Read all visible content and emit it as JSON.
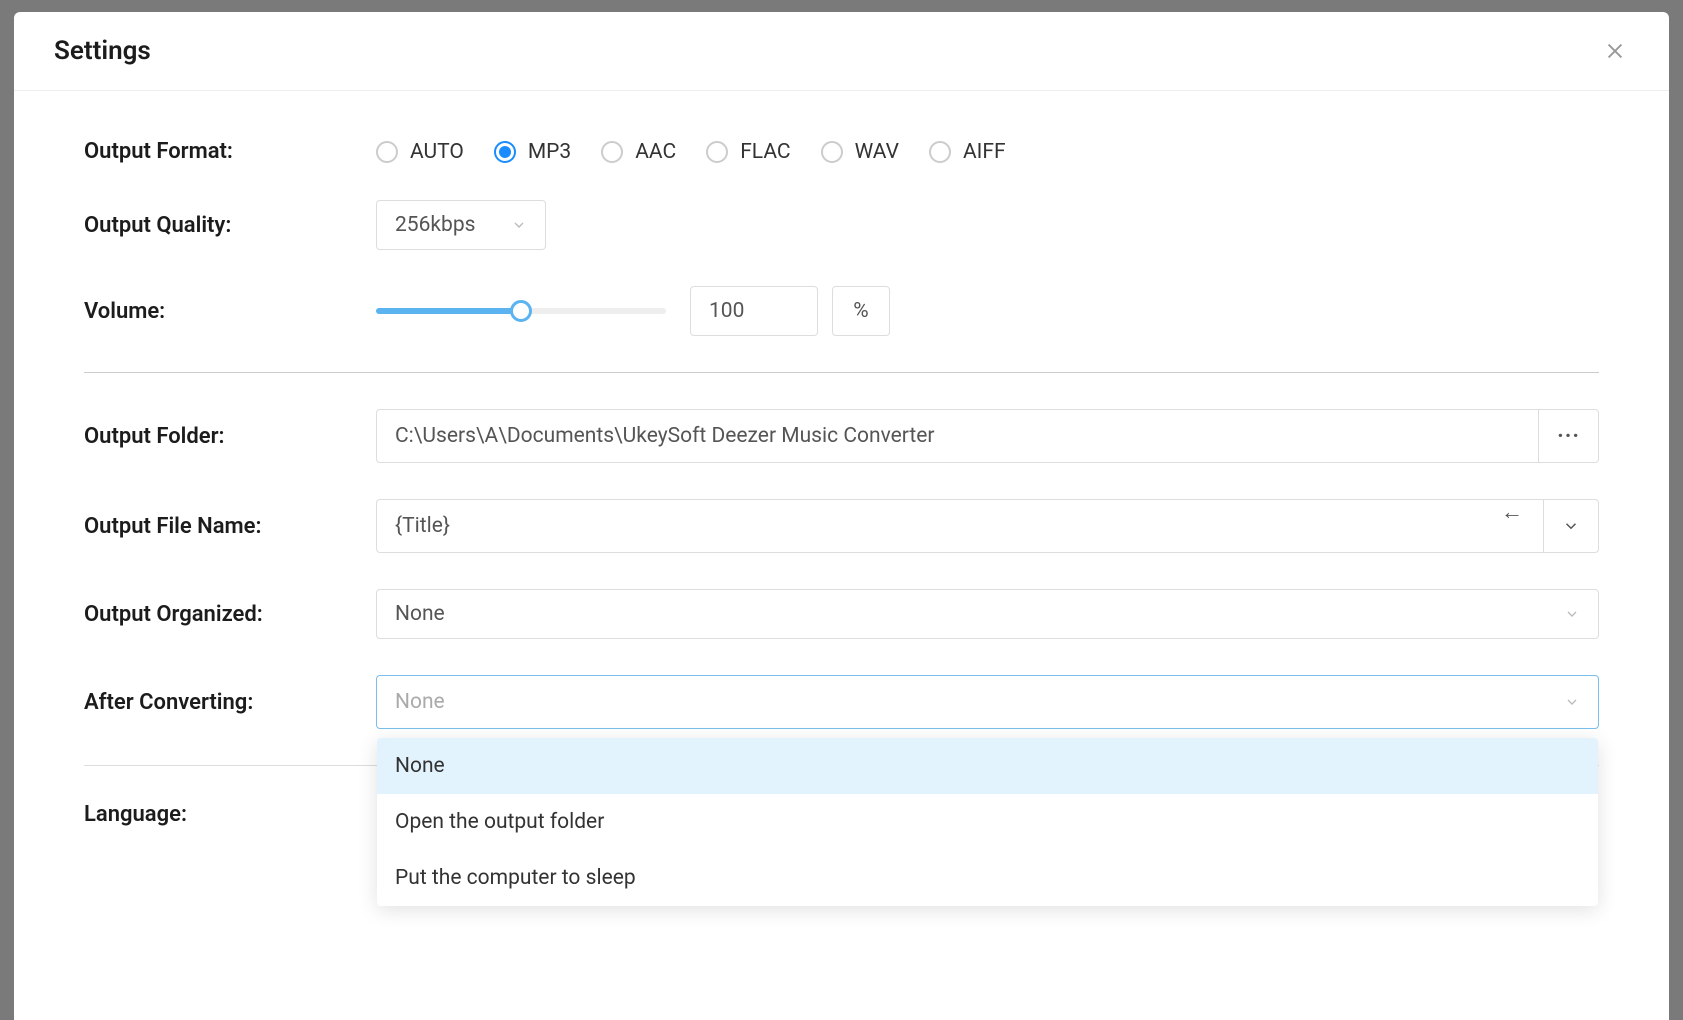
{
  "title": "Settings",
  "labels": {
    "output_format": "Output Format:",
    "output_quality": "Output Quality:",
    "volume": "Volume:",
    "output_folder": "Output Folder:",
    "output_file_name": "Output File Name:",
    "output_organized": "Output Organized:",
    "after_converting": "After Converting:",
    "language": "Language:"
  },
  "output_format": {
    "options": [
      "AUTO",
      "MP3",
      "AAC",
      "FLAC",
      "WAV",
      "AIFF"
    ],
    "selected": "MP3"
  },
  "output_quality": {
    "value": "256kbps"
  },
  "volume": {
    "value": "100",
    "unit": "%",
    "percent": 50
  },
  "output_folder": {
    "value": "C:\\Users\\A\\Documents\\UkeySoft Deezer Music Converter"
  },
  "output_file_name": {
    "value": "{Title}"
  },
  "output_organized": {
    "value": "None"
  },
  "after_converting": {
    "value": "None",
    "options": [
      "None",
      "Open the output folder",
      "Put the computer to sleep"
    ],
    "highlighted": "None"
  }
}
